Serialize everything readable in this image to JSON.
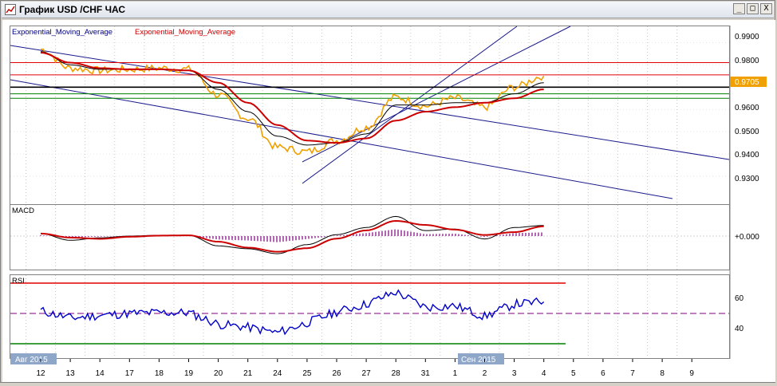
{
  "window": {
    "title": "График USD /CHF ЧАС",
    "buttons": [
      "_",
      "□",
      "X"
    ],
    "icons": [
      "chart-icon",
      "minimize-icon",
      "maximize-icon",
      "close-icon"
    ]
  },
  "main_panel": {
    "indicator_labels": [
      "Exponential_Moving_Average",
      "Exponential_Moving_Average"
    ],
    "label_colors": [
      "#000080",
      "#cc0000"
    ],
    "price_ticks": [
      "0.9900",
      "0.9800",
      "0.9700",
      "0.9600",
      "0.9500",
      "0.9400",
      "0.9300"
    ],
    "current_price": "0.9705"
  },
  "macd_panel": {
    "label": "MACD",
    "tick": "+0.000"
  },
  "rsi_panel": {
    "label": "RSI",
    "ticks": [
      "60",
      "40"
    ]
  },
  "period_labels": [
    "Авг 2015",
    "Сен 2015"
  ],
  "x_axis": [
    "12",
    "13",
    "14",
    "17",
    "18",
    "19",
    "20",
    "21",
    "24",
    "25",
    "26",
    "27",
    "28",
    "31",
    "1",
    "2",
    "3",
    "4",
    "5",
    "6",
    "7",
    "8",
    "9"
  ],
  "colors": {
    "price": "#f0a000",
    "ema_fast": "#000000",
    "ema_slow": "#cc0000",
    "channel": "#1a1a8c",
    "rsi": "#0000c8",
    "level_red": "#e00000",
    "level_green": "#008000",
    "current_price_bg": "#f0a000"
  },
  "chart_data": {
    "type": "line",
    "title": "График USD /CHF ЧАС",
    "ylim": [
      0.925,
      0.993
    ],
    "x": [
      "12",
      "13",
      "14",
      "17",
      "18",
      "19",
      "20",
      "21",
      "24",
      "25",
      "26",
      "27",
      "28",
      "31",
      "1",
      "2",
      "3",
      "4"
    ],
    "series": [
      {
        "name": "",
        "values": [
          0.987,
          0.9785,
          0.9775,
          0.978,
          0.9785,
          0.978,
          0.9665,
          0.956,
          0.943,
          0.941,
          0.946,
          0.952,
          0.9655,
          0.9615,
          0.965,
          0.961,
          0.97,
          0.975
        ]
      },
      {
        "name": "Exponential_Moving_Average",
        "values": [
          0.986,
          0.98,
          0.978,
          0.978,
          0.978,
          0.9775,
          0.969,
          0.959,
          0.948,
          0.944,
          0.945,
          0.949,
          0.962,
          0.962,
          0.963,
          0.963,
          0.967,
          0.972
        ]
      },
      {
        "name": "Exponential_Moving_Average",
        "values": [
          0.9855,
          0.981,
          0.9785,
          0.978,
          0.978,
          0.9775,
          0.972,
          0.963,
          0.953,
          0.946,
          0.945,
          0.947,
          0.955,
          0.959,
          0.961,
          0.963,
          0.965,
          0.969
        ]
      }
    ],
    "horizontal_levels": [
      0.981,
      0.9755,
      0.97,
      0.967,
      0.965
    ],
    "rsi_levels": [
      70,
      30
    ],
    "grid": true
  }
}
